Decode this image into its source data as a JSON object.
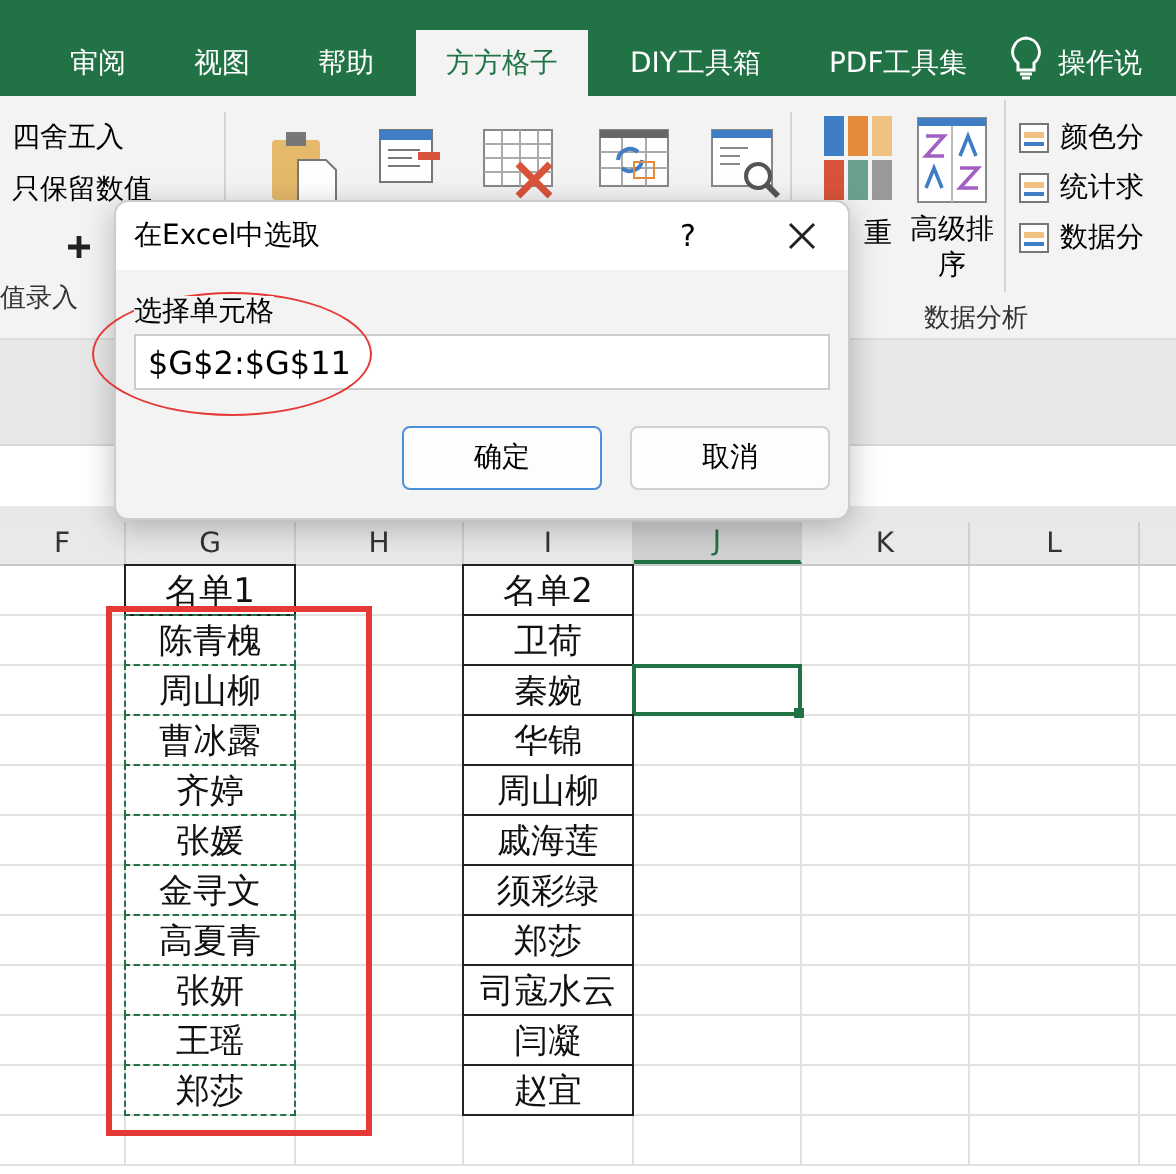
{
  "tabs": [
    {
      "label": "审阅",
      "selected": false
    },
    {
      "label": "视图",
      "selected": false
    },
    {
      "label": "帮助",
      "selected": false
    },
    {
      "label": "方方格子",
      "selected": true
    },
    {
      "label": "DIY工具箱",
      "selected": false
    },
    {
      "label": "PDF工具集",
      "selected": false
    }
  ],
  "tell_me": "操作说",
  "ribbon": {
    "left_commands": [
      {
        "label": "四舍五入"
      },
      {
        "label": "只保留数值"
      }
    ],
    "left_group_label": "值录入",
    "dup_label": "重",
    "sort_label": "高级排序",
    "right_commands": [
      {
        "label": "颜色分"
      },
      {
        "label": "统计求"
      },
      {
        "label": "数据分"
      }
    ],
    "analysis_group_label": "数据分析"
  },
  "dialog": {
    "title": "在Excel中选取",
    "help": "?",
    "field_label": "选择单元格",
    "field_value": "$G$2:$G$11",
    "buttons": [
      {
        "label": "确定",
        "default": true
      },
      {
        "label": "取消",
        "default": false
      }
    ]
  },
  "sheet": {
    "columns": [
      {
        "label": "F",
        "selected": false
      },
      {
        "label": "G",
        "selected": false
      },
      {
        "label": "H",
        "selected": false
      },
      {
        "label": "I",
        "selected": false
      },
      {
        "label": "J",
        "selected": true
      },
      {
        "label": "K",
        "selected": false
      },
      {
        "label": "L",
        "selected": false
      }
    ],
    "list1": {
      "header": "名单1",
      "names": [
        "陈青槐",
        "周山柳",
        "曹冰露",
        "齐婷",
        "张媛",
        "金寻文",
        "高夏青",
        "张妍",
        "王瑶",
        "郑莎"
      ],
      "copy_marquee": true
    },
    "list2": {
      "header": "名单2",
      "names": [
        "卫荷",
        "秦婉",
        "华锦",
        "周山柳",
        "戚海莲",
        "须彩绿",
        "郑莎",
        "司寇水云",
        "闫凝",
        "赵宜"
      ]
    },
    "column_j_cells": [
      {
        "selected": false
      },
      {
        "selected": false
      },
      {
        "selected": true
      },
      {
        "selected": false
      },
      {
        "selected": false
      },
      {
        "selected": false
      },
      {
        "selected": false
      },
      {
        "selected": false
      },
      {
        "selected": false
      },
      {
        "selected": false
      },
      {
        "selected": false
      }
    ]
  },
  "annotations": [
    {
      "kind": "ellipse"
    },
    {
      "kind": "rectangle"
    }
  ]
}
